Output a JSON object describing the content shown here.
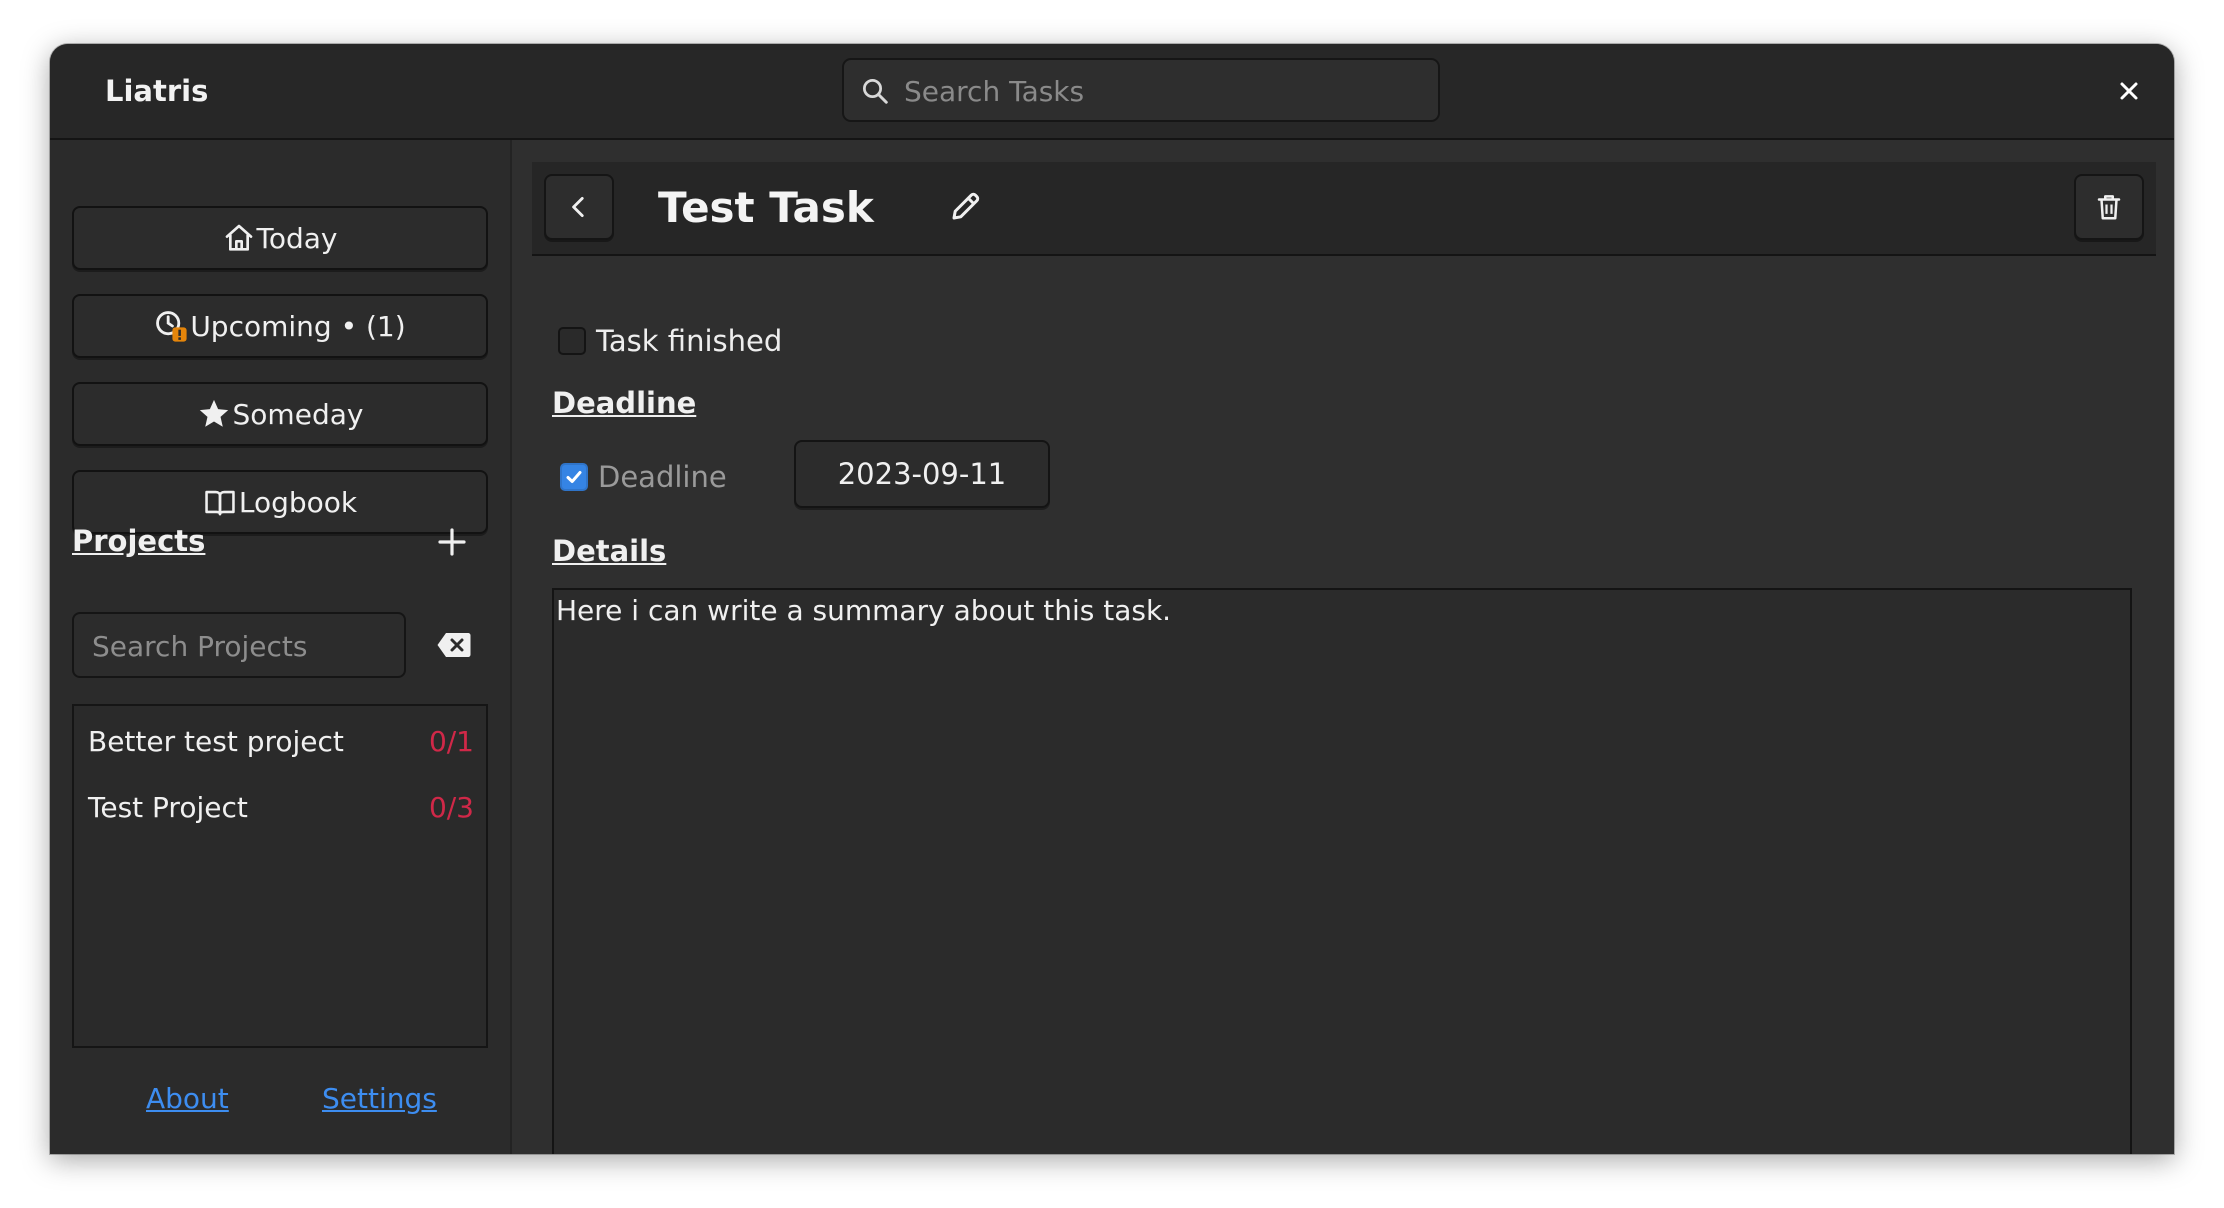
{
  "window": {
    "title": "Liatris"
  },
  "header": {
    "search_placeholder": "Search Tasks"
  },
  "sidebar": {
    "nav": [
      {
        "label": "Today",
        "icon": "home-icon"
      },
      {
        "label": "Upcoming • (1)",
        "icon": "clock-alert-icon"
      },
      {
        "label": "Someday",
        "icon": "star-icon"
      },
      {
        "label": "Logbook",
        "icon": "book-icon"
      }
    ],
    "projects_heading": "Projects",
    "search_placeholder": "Search Projects",
    "projects": [
      {
        "name": "Better test project",
        "count": "0/1"
      },
      {
        "name": "Test Project",
        "count": "0/3"
      }
    ],
    "footer": {
      "about": "About",
      "settings": "Settings"
    }
  },
  "task": {
    "title": "Test Task",
    "finished_label": "Task finished",
    "finished": false,
    "deadline_heading": "Deadline",
    "deadline_label": "Deadline",
    "deadline_enabled": true,
    "deadline_date": "2023-09-11",
    "details_heading": "Details",
    "details_text": "Here i can write a summary about this task."
  },
  "colors": {
    "accent": "#3584e4",
    "link": "#3d8df0",
    "count": "#d02848",
    "warning": "#e5850a"
  }
}
